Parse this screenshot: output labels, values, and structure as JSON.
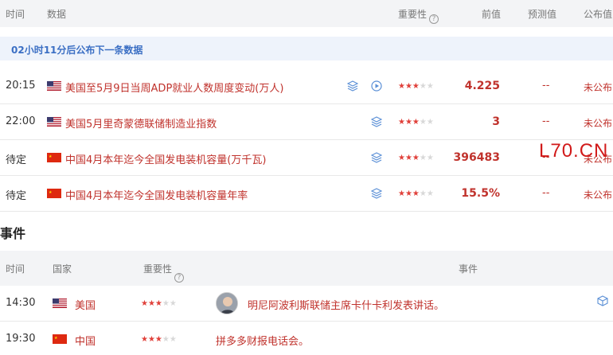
{
  "header": {
    "time": "时间",
    "data": "数据",
    "importance": "重要性",
    "previous": "前值",
    "forecast": "预测值",
    "published": "公布值"
  },
  "banner": "02小时11分后公布下一条数据",
  "rows": [
    {
      "time": "20:15",
      "country": "美国",
      "title": "美国至5月9日当周ADP就业人数周度变动(万人)",
      "stars": 3,
      "previous": "4.225",
      "forecast": "--",
      "published": "未公布"
    },
    {
      "time": "22:00",
      "country": "美国",
      "title": "美国5月里奇蒙德联储制造业指数",
      "stars": 3,
      "previous": "3",
      "forecast": "--",
      "published": "未公布"
    },
    {
      "time": "待定",
      "country": "中国",
      "title": "中国4月本年迄今全国发电装机容量(万千瓦)",
      "stars": 3,
      "previous": "396483",
      "forecast": "--",
      "published": "未公布"
    },
    {
      "time": "待定",
      "country": "中国",
      "title": "中国4月本年迄今全国发电装机容量年率",
      "stars": 3,
      "previous": "15.5%",
      "forecast": "--",
      "published": "未公布"
    }
  ],
  "events_title": "事件",
  "events_header": {
    "time": "时间",
    "country": "国家",
    "importance": "重要性",
    "event": "事件"
  },
  "events": [
    {
      "time": "14:30",
      "country": "美国",
      "stars": 3,
      "text": "明尼阿波利斯联储主席卡什卡利发表讲话。"
    },
    {
      "time": "19:30",
      "country": "中国",
      "stars": 3,
      "text": "拼多多财报电话会。"
    }
  ],
  "watermark": "L70.CN",
  "colors": {
    "accent_red": "#c0322c",
    "banner_blue": "#3b6fc4",
    "star_on": "#e0403a"
  }
}
